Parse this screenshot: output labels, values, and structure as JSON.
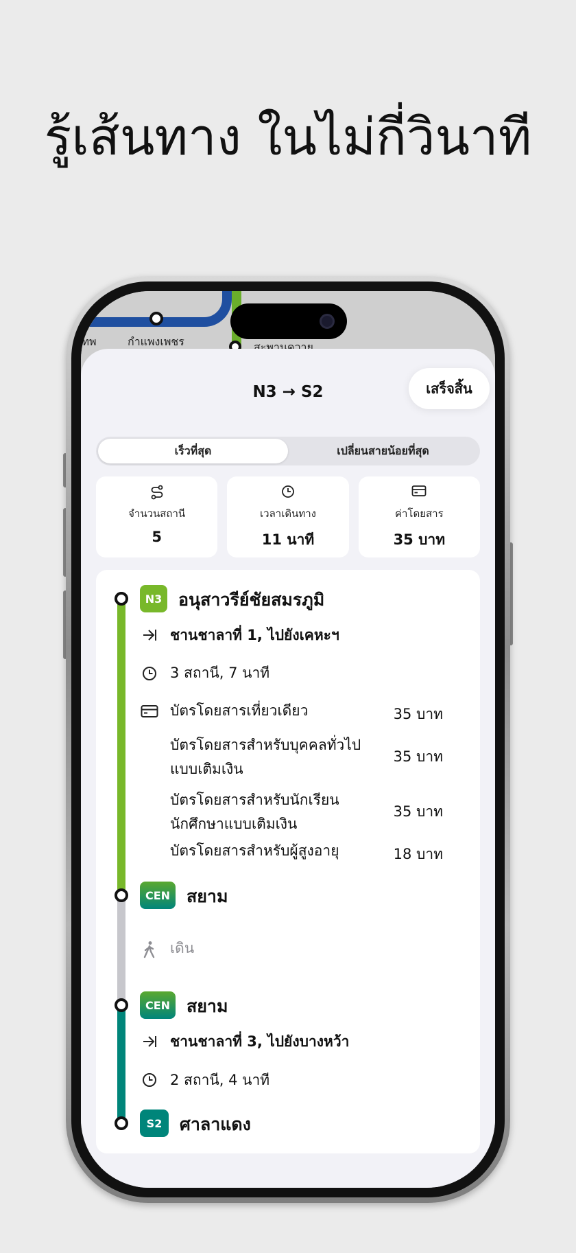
{
  "headline": "รู้เส้นทาง ในไม่กี่วินาที",
  "map": {
    "labels": [
      "เทพ",
      "กำแพงเพชร",
      "สะพานควาย"
    ]
  },
  "sheet": {
    "title": "N3 → S2",
    "done_label": "เสร็จสิ้น"
  },
  "segmented": {
    "options": [
      "เร็วที่สุด",
      "เปลี่ยนสายน้อยที่สุด"
    ],
    "selected": "เร็วที่สุด"
  },
  "stats": [
    {
      "icon": "route-icon",
      "label": "จำนวนสถานี",
      "value": "5"
    },
    {
      "icon": "clock-icon",
      "label": "เวลาเดินทาง",
      "value": "11 นาที"
    },
    {
      "icon": "card-icon",
      "label": "ค่าโดยสาร",
      "value": "35 บาท"
    }
  ],
  "route": {
    "stop1": {
      "code": "N3",
      "name": "อนุสาวรีย์ชัยสมรภูมิ"
    },
    "leg1": {
      "direction": "ชานชาลาที่ 1, ไปยังเคหะฯ",
      "duration": "3 สถานี, 7 นาที",
      "fares": [
        {
          "label": "บัตรโดยสารเที่ยวเดียว",
          "price": "35 บาท"
        },
        {
          "label": "บัตรโดยสารสำหรับบุคคลทั่วไปแบบเติมเงิน",
          "price": "35 บาท"
        },
        {
          "label": "บัตรโดยสารสำหรับนักเรียนนักศึกษาแบบเติมเงิน",
          "price": "35 บาท"
        },
        {
          "label": "บัตรโดยสารสำหรับผู้สูงอายุ",
          "price": "18 บาท"
        }
      ]
    },
    "stop2": {
      "code": "CEN",
      "name": "สยาม"
    },
    "walk": "เดิน",
    "stop3": {
      "code": "CEN",
      "name": "สยาม"
    },
    "leg2": {
      "direction": "ชานชาลาที่ 3, ไปยังบางหว้า",
      "duration": "2 สถานี, 4 นาที"
    },
    "stop4": {
      "code": "S2",
      "name": "ศาลาแดง"
    }
  },
  "colors": {
    "sukhumvit": "#78b82a",
    "silom": "#00857a",
    "walk": "#c7c7cc",
    "blue_line": "#1f4fa0"
  }
}
